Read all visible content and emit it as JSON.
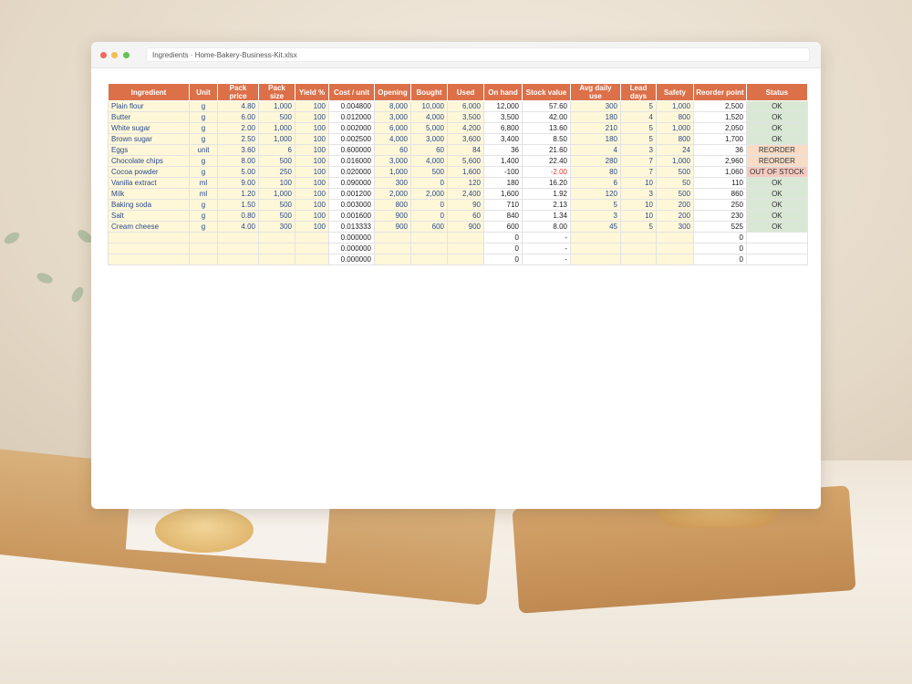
{
  "window": {
    "title": "Ingredients · Home-Bakery-Business-Kit.xlsx"
  },
  "columns": [
    "Ingredient",
    "Unit",
    "Pack price",
    "Pack size",
    "Yield %",
    "Cost / unit",
    "Opening",
    "Bought",
    "Used",
    "On hand",
    "Stock value",
    "Avg daily use",
    "Lead days",
    "Safety",
    "Reorder point",
    "Status"
  ],
  "rows": [
    {
      "ingredient": "Plain flour",
      "unit": "g",
      "pack_price": "4.80",
      "pack_size": "1,000",
      "yield": "100",
      "cost_unit": "0.004800",
      "opening": "8,000",
      "bought": "10,000",
      "used": "6,000",
      "on_hand": "12,000",
      "stock_value": "57.60",
      "avg_daily": "300",
      "lead": "5",
      "safety": "1,000",
      "reorder": "2,500",
      "status": "OK"
    },
    {
      "ingredient": "Butter",
      "unit": "g",
      "pack_price": "6.00",
      "pack_size": "500",
      "yield": "100",
      "cost_unit": "0.012000",
      "opening": "3,000",
      "bought": "4,000",
      "used": "3,500",
      "on_hand": "3,500",
      "stock_value": "42.00",
      "avg_daily": "180",
      "lead": "4",
      "safety": "800",
      "reorder": "1,520",
      "status": "OK"
    },
    {
      "ingredient": "White sugar",
      "unit": "g",
      "pack_price": "2.00",
      "pack_size": "1,000",
      "yield": "100",
      "cost_unit": "0.002000",
      "opening": "6,000",
      "bought": "5,000",
      "used": "4,200",
      "on_hand": "6,800",
      "stock_value": "13.60",
      "avg_daily": "210",
      "lead": "5",
      "safety": "1,000",
      "reorder": "2,050",
      "status": "OK"
    },
    {
      "ingredient": "Brown sugar",
      "unit": "g",
      "pack_price": "2.50",
      "pack_size": "1,000",
      "yield": "100",
      "cost_unit": "0.002500",
      "opening": "4,000",
      "bought": "3,000",
      "used": "3,600",
      "on_hand": "3,400",
      "stock_value": "8.50",
      "avg_daily": "180",
      "lead": "5",
      "safety": "800",
      "reorder": "1,700",
      "status": "OK"
    },
    {
      "ingredient": "Eggs",
      "unit": "unit",
      "pack_price": "3.60",
      "pack_size": "6",
      "yield": "100",
      "cost_unit": "0.600000",
      "opening": "60",
      "bought": "60",
      "used": "84",
      "on_hand": "36",
      "stock_value": "21.60",
      "avg_daily": "4",
      "lead": "3",
      "safety": "24",
      "reorder": "36",
      "status": "REORDER"
    },
    {
      "ingredient": "Chocolate chips",
      "unit": "g",
      "pack_price": "8.00",
      "pack_size": "500",
      "yield": "100",
      "cost_unit": "0.016000",
      "opening": "3,000",
      "bought": "4,000",
      "used": "5,600",
      "on_hand": "1,400",
      "stock_value": "22.40",
      "avg_daily": "280",
      "lead": "7",
      "safety": "1,000",
      "reorder": "2,960",
      "status": "REORDER"
    },
    {
      "ingredient": "Cocoa powder",
      "unit": "g",
      "pack_price": "5.00",
      "pack_size": "250",
      "yield": "100",
      "cost_unit": "0.020000",
      "opening": "1,000",
      "bought": "500",
      "used": "1,600",
      "on_hand": "-100",
      "stock_value": "-2.00",
      "avg_daily": "80",
      "lead": "7",
      "safety": "500",
      "reorder": "1,060",
      "status": "OUT OF STOCK"
    },
    {
      "ingredient": "Vanilla extract",
      "unit": "ml",
      "pack_price": "9.00",
      "pack_size": "100",
      "yield": "100",
      "cost_unit": "0.090000",
      "opening": "300",
      "bought": "0",
      "used": "120",
      "on_hand": "180",
      "stock_value": "16.20",
      "avg_daily": "6",
      "lead": "10",
      "safety": "50",
      "reorder": "110",
      "status": "OK"
    },
    {
      "ingredient": "Milk",
      "unit": "ml",
      "pack_price": "1.20",
      "pack_size": "1,000",
      "yield": "100",
      "cost_unit": "0.001200",
      "opening": "2,000",
      "bought": "2,000",
      "used": "2,400",
      "on_hand": "1,600",
      "stock_value": "1.92",
      "avg_daily": "120",
      "lead": "3",
      "safety": "500",
      "reorder": "860",
      "status": "OK"
    },
    {
      "ingredient": "Baking soda",
      "unit": "g",
      "pack_price": "1.50",
      "pack_size": "500",
      "yield": "100",
      "cost_unit": "0.003000",
      "opening": "800",
      "bought": "0",
      "used": "90",
      "on_hand": "710",
      "stock_value": "2.13",
      "avg_daily": "5",
      "lead": "10",
      "safety": "200",
      "reorder": "250",
      "status": "OK"
    },
    {
      "ingredient": "Salt",
      "unit": "g",
      "pack_price": "0.80",
      "pack_size": "500",
      "yield": "100",
      "cost_unit": "0.001600",
      "opening": "900",
      "bought": "0",
      "used": "60",
      "on_hand": "840",
      "stock_value": "1.34",
      "avg_daily": "3",
      "lead": "10",
      "safety": "200",
      "reorder": "230",
      "status": "OK"
    },
    {
      "ingredient": "Cream cheese",
      "unit": "g",
      "pack_price": "4.00",
      "pack_size": "300",
      "yield": "100",
      "cost_unit": "0.013333",
      "opening": "900",
      "bought": "600",
      "used": "900",
      "on_hand": "600",
      "stock_value": "8.00",
      "avg_daily": "45",
      "lead": "5",
      "safety": "300",
      "reorder": "525",
      "status": "OK"
    },
    {
      "ingredient": "",
      "unit": "",
      "pack_price": "",
      "pack_size": "",
      "yield": "",
      "cost_unit": "0.000000",
      "opening": "",
      "bought": "",
      "used": "",
      "on_hand": "0",
      "stock_value": "-",
      "avg_daily": "",
      "lead": "",
      "safety": "",
      "reorder": "0",
      "status": ""
    },
    {
      "ingredient": "",
      "unit": "",
      "pack_price": "",
      "pack_size": "",
      "yield": "",
      "cost_unit": "0.000000",
      "opening": "",
      "bought": "",
      "used": "",
      "on_hand": "0",
      "stock_value": "-",
      "avg_daily": "",
      "lead": "",
      "safety": "",
      "reorder": "0",
      "status": ""
    },
    {
      "ingredient": "",
      "unit": "",
      "pack_price": "",
      "pack_size": "",
      "yield": "",
      "cost_unit": "0.000000",
      "opening": "",
      "bought": "",
      "used": "",
      "on_hand": "0",
      "stock_value": "-",
      "avg_daily": "",
      "lead": "",
      "safety": "",
      "reorder": "0",
      "status": ""
    }
  ],
  "colors": {
    "header_bg": "#dc7049",
    "input_bg": "#fef7d8",
    "input_text": "#2a4b8f",
    "ok_bg": "#d8e8d4",
    "reorder_bg": "#f8dcc7",
    "out_of_stock_bg": "#f5c9c0",
    "negative_text": "#e03a2f"
  }
}
